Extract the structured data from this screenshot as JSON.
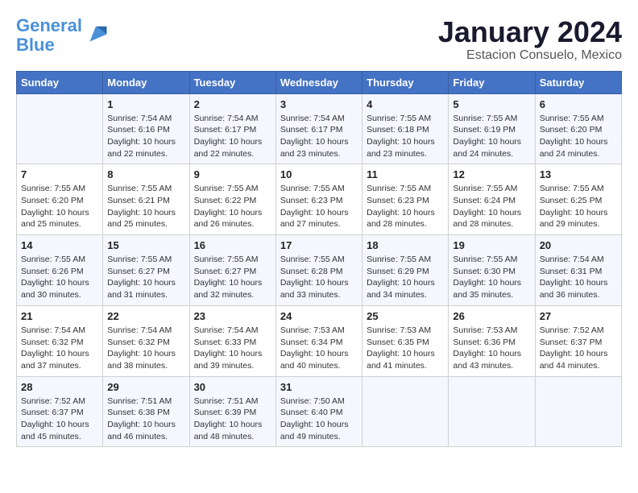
{
  "header": {
    "logo_line1": "General",
    "logo_line2": "Blue",
    "month": "January 2024",
    "location": "Estacion Consuelo, Mexico"
  },
  "days_of_week": [
    "Sunday",
    "Monday",
    "Tuesday",
    "Wednesday",
    "Thursday",
    "Friday",
    "Saturday"
  ],
  "weeks": [
    [
      {
        "day": "",
        "content": ""
      },
      {
        "day": "1",
        "content": "Sunrise: 7:54 AM\nSunset: 6:16 PM\nDaylight: 10 hours\nand 22 minutes."
      },
      {
        "day": "2",
        "content": "Sunrise: 7:54 AM\nSunset: 6:17 PM\nDaylight: 10 hours\nand 22 minutes."
      },
      {
        "day": "3",
        "content": "Sunrise: 7:54 AM\nSunset: 6:17 PM\nDaylight: 10 hours\nand 23 minutes."
      },
      {
        "day": "4",
        "content": "Sunrise: 7:55 AM\nSunset: 6:18 PM\nDaylight: 10 hours\nand 23 minutes."
      },
      {
        "day": "5",
        "content": "Sunrise: 7:55 AM\nSunset: 6:19 PM\nDaylight: 10 hours\nand 24 minutes."
      },
      {
        "day": "6",
        "content": "Sunrise: 7:55 AM\nSunset: 6:20 PM\nDaylight: 10 hours\nand 24 minutes."
      }
    ],
    [
      {
        "day": "7",
        "content": "Sunrise: 7:55 AM\nSunset: 6:20 PM\nDaylight: 10 hours\nand 25 minutes."
      },
      {
        "day": "8",
        "content": "Sunrise: 7:55 AM\nSunset: 6:21 PM\nDaylight: 10 hours\nand 25 minutes."
      },
      {
        "day": "9",
        "content": "Sunrise: 7:55 AM\nSunset: 6:22 PM\nDaylight: 10 hours\nand 26 minutes."
      },
      {
        "day": "10",
        "content": "Sunrise: 7:55 AM\nSunset: 6:23 PM\nDaylight: 10 hours\nand 27 minutes."
      },
      {
        "day": "11",
        "content": "Sunrise: 7:55 AM\nSunset: 6:23 PM\nDaylight: 10 hours\nand 28 minutes."
      },
      {
        "day": "12",
        "content": "Sunrise: 7:55 AM\nSunset: 6:24 PM\nDaylight: 10 hours\nand 28 minutes."
      },
      {
        "day": "13",
        "content": "Sunrise: 7:55 AM\nSunset: 6:25 PM\nDaylight: 10 hours\nand 29 minutes."
      }
    ],
    [
      {
        "day": "14",
        "content": "Sunrise: 7:55 AM\nSunset: 6:26 PM\nDaylight: 10 hours\nand 30 minutes."
      },
      {
        "day": "15",
        "content": "Sunrise: 7:55 AM\nSunset: 6:27 PM\nDaylight: 10 hours\nand 31 minutes."
      },
      {
        "day": "16",
        "content": "Sunrise: 7:55 AM\nSunset: 6:27 PM\nDaylight: 10 hours\nand 32 minutes."
      },
      {
        "day": "17",
        "content": "Sunrise: 7:55 AM\nSunset: 6:28 PM\nDaylight: 10 hours\nand 33 minutes."
      },
      {
        "day": "18",
        "content": "Sunrise: 7:55 AM\nSunset: 6:29 PM\nDaylight: 10 hours\nand 34 minutes."
      },
      {
        "day": "19",
        "content": "Sunrise: 7:55 AM\nSunset: 6:30 PM\nDaylight: 10 hours\nand 35 minutes."
      },
      {
        "day": "20",
        "content": "Sunrise: 7:54 AM\nSunset: 6:31 PM\nDaylight: 10 hours\nand 36 minutes."
      }
    ],
    [
      {
        "day": "21",
        "content": "Sunrise: 7:54 AM\nSunset: 6:32 PM\nDaylight: 10 hours\nand 37 minutes."
      },
      {
        "day": "22",
        "content": "Sunrise: 7:54 AM\nSunset: 6:32 PM\nDaylight: 10 hours\nand 38 minutes."
      },
      {
        "day": "23",
        "content": "Sunrise: 7:54 AM\nSunset: 6:33 PM\nDaylight: 10 hours\nand 39 minutes."
      },
      {
        "day": "24",
        "content": "Sunrise: 7:53 AM\nSunset: 6:34 PM\nDaylight: 10 hours\nand 40 minutes."
      },
      {
        "day": "25",
        "content": "Sunrise: 7:53 AM\nSunset: 6:35 PM\nDaylight: 10 hours\nand 41 minutes."
      },
      {
        "day": "26",
        "content": "Sunrise: 7:53 AM\nSunset: 6:36 PM\nDaylight: 10 hours\nand 43 minutes."
      },
      {
        "day": "27",
        "content": "Sunrise: 7:52 AM\nSunset: 6:37 PM\nDaylight: 10 hours\nand 44 minutes."
      }
    ],
    [
      {
        "day": "28",
        "content": "Sunrise: 7:52 AM\nSunset: 6:37 PM\nDaylight: 10 hours\nand 45 minutes."
      },
      {
        "day": "29",
        "content": "Sunrise: 7:51 AM\nSunset: 6:38 PM\nDaylight: 10 hours\nand 46 minutes."
      },
      {
        "day": "30",
        "content": "Sunrise: 7:51 AM\nSunset: 6:39 PM\nDaylight: 10 hours\nand 48 minutes."
      },
      {
        "day": "31",
        "content": "Sunrise: 7:50 AM\nSunset: 6:40 PM\nDaylight: 10 hours\nand 49 minutes."
      },
      {
        "day": "",
        "content": ""
      },
      {
        "day": "",
        "content": ""
      },
      {
        "day": "",
        "content": ""
      }
    ]
  ]
}
